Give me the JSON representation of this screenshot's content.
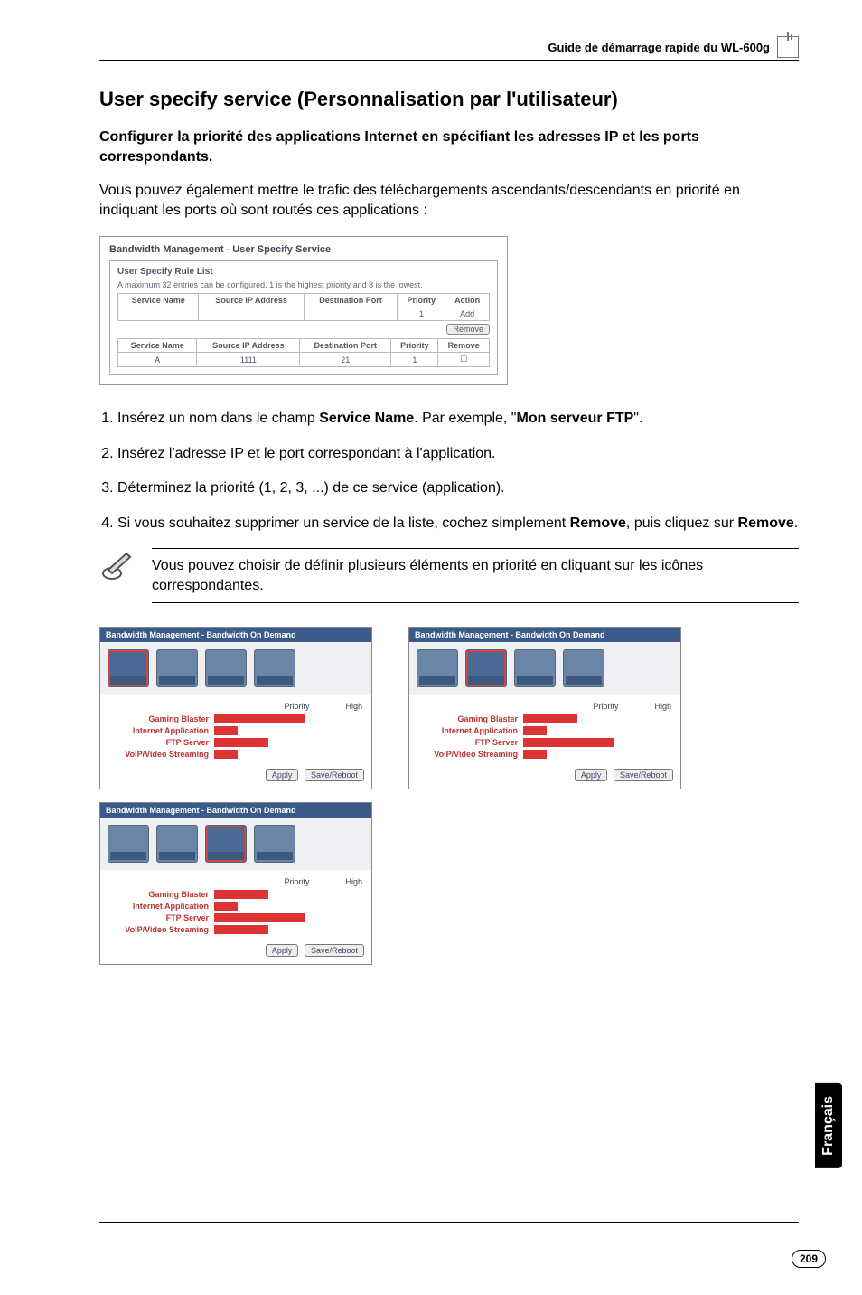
{
  "header": {
    "guide": "Guide de démarrage rapide du WL-600g"
  },
  "title": "User specify service (Personnalisation par l'utilisateur)",
  "subhead": "Configurer la priorité des applications Internet en spécifiant les adresses IP et les ports correspondants.",
  "intro": "Vous pouvez également mettre le trafic des téléchargements ascendants/descendants en priorité en indiquant les ports où sont routés ces applications :",
  "scr1": {
    "caption": "Bandwidth Management - User Specify Service",
    "subtitle": "User Specify Rule List",
    "note": "A maximum 32 entries can be configured. 1 is the highest priority and 8 is the lowest.",
    "cols": [
      "Service Name",
      "Source IP Address",
      "Destination Port",
      "Priority",
      "Action"
    ],
    "row1": [
      "",
      "",
      "",
      "1",
      ""
    ],
    "addBtn": "Add",
    "removeBtn": "Remove",
    "cols2": [
      "Service Name",
      "Source IP Address",
      "Destination Port",
      "Priority",
      "Remove"
    ],
    "row2": [
      "A",
      "1111",
      "21",
      "1",
      "☐"
    ]
  },
  "steps": {
    "s1a": "Insérez un nom dans le champ ",
    "s1b": "Service Name",
    "s1c": ". Par exemple, \"",
    "s1d": "Mon serveur FTP",
    "s1e": "\".",
    "s2": "Insérez l'adresse IP et le port correspondant à l'application.",
    "s3": "Déterminez la priorité (1, 2, 3, ...) de ce service (application).",
    "s4a": "Si vous souhaitez supprimer un service de la liste, cochez simplement ",
    "s4b": "Remove",
    "s4c": ", puis cliquez sur ",
    "s4d": "Remove",
    "s4e": "."
  },
  "note_box": "Vous pouvez choisir de définir plusieurs éléments en priorité en cliquant sur les icônes correspondantes.",
  "shot": {
    "title": "Bandwidth Management - Bandwidth On Demand",
    "priorityHdr": "Priority",
    "levelHdr": "High",
    "rows": [
      "Gaming Blaster",
      "Internet Application",
      "FTP Server",
      "VoIP/Video Streaming"
    ],
    "apply": "Apply",
    "reset": "Save/Reboot"
  },
  "sidetab": "Français",
  "pagenum": "209"
}
